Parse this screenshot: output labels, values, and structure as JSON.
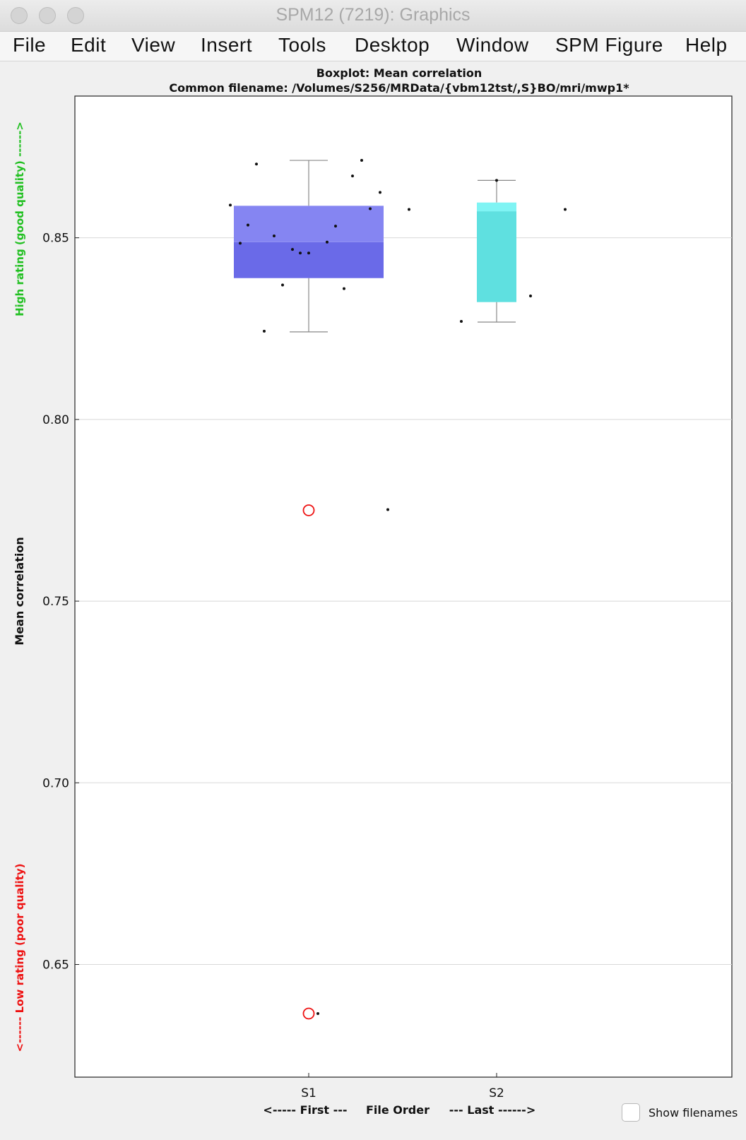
{
  "window": {
    "title": "SPM12 (7219): Graphics"
  },
  "menu": [
    "File",
    "Edit",
    "View",
    "Insert",
    "Tools",
    "Desktop",
    "Window",
    "SPM Figure",
    "Help"
  ],
  "footer": {
    "first_label": "<----- First ---",
    "order_label": "File Order",
    "last_label": "--- Last ------>",
    "show_filenames_label": "Show filenames"
  },
  "colors": {
    "s1_box": "#6a6ae8",
    "s1_box_upper": "#8585f2",
    "s2_box": "#5fe0e0",
    "s2_box_upper": "#7ff4f4",
    "good": "#22c022",
    "poor": "#ee1111",
    "outlier": "#ee1111"
  },
  "chart_data": {
    "type": "box",
    "title": "Boxplot: Mean correlation",
    "subtitle": "Common filename: /Volumes/S256/MRData/{vbm12tst/,S}BO/mri/mwp1*",
    "xlabel": "",
    "ylabel": "Mean correlation",
    "ylabel_high": "High rating (good quality) ------>",
    "ylabel_low": "<------ Low rating (poor quality)",
    "categories": [
      "S1",
      "S2"
    ],
    "ylim": [
      0.619,
      0.889
    ],
    "yticks": [
      0.65,
      0.7,
      0.75,
      0.8,
      0.85
    ],
    "ytick_labels": [
      "0.65",
      "0.70",
      "0.75",
      "0.80",
      "0.85"
    ],
    "grid": true,
    "boxes": [
      {
        "name": "S1",
        "q1": 0.8389,
        "median": 0.8488,
        "q3": 0.8588,
        "whisker_low": 0.8241,
        "whisker_high": 0.8713
      },
      {
        "name": "S2",
        "q1": 0.8323,
        "median": 0.8573,
        "q3": 0.8597,
        "whisker_low": 0.8268,
        "whisker_high": 0.8658
      }
    ],
    "outliers": [
      {
        "series": "S1",
        "y": 0.775
      },
      {
        "series": "S1",
        "y": 0.6365
      }
    ],
    "points": [
      {
        "series": "S1",
        "offset": -1.11,
        "y": 0.859
      },
      {
        "series": "S1",
        "offset": -0.97,
        "y": 0.8485
      },
      {
        "series": "S1",
        "offset": -0.86,
        "y": 0.8535
      },
      {
        "series": "S1",
        "offset": -0.74,
        "y": 0.8703
      },
      {
        "series": "S1",
        "offset": -0.63,
        "y": 0.8243
      },
      {
        "series": "S1",
        "offset": -0.49,
        "y": 0.8505
      },
      {
        "series": "S1",
        "offset": -0.37,
        "y": 0.837
      },
      {
        "series": "S1",
        "offset": -0.23,
        "y": 0.8468
      },
      {
        "series": "S1",
        "offset": -0.12,
        "y": 0.8458
      },
      {
        "series": "S1",
        "offset": 0.0,
        "y": 0.8458
      },
      {
        "series": "S1",
        "offset": 0.26,
        "y": 0.8488
      },
      {
        "series": "S1",
        "offset": 0.38,
        "y": 0.8532
      },
      {
        "series": "S1",
        "offset": 0.5,
        "y": 0.836
      },
      {
        "series": "S1",
        "offset": 0.62,
        "y": 0.867
      },
      {
        "series": "S1",
        "offset": 0.75,
        "y": 0.8713
      },
      {
        "series": "S1",
        "offset": 0.87,
        "y": 0.858
      },
      {
        "series": "S1",
        "offset": 1.01,
        "y": 0.8625
      },
      {
        "series": "S1",
        "offset": 1.12,
        "y": 0.7752
      },
      {
        "series": "S1",
        "offset": 1.42,
        "y": 0.8578
      },
      {
        "series": "S1",
        "offset": 0.13,
        "y": 0.6365
      },
      {
        "series": "S2",
        "offset": -0.5,
        "y": 0.827
      },
      {
        "series": "S2",
        "offset": 0.0,
        "y": 0.8658
      },
      {
        "series": "S2",
        "offset": 0.48,
        "y": 0.834
      },
      {
        "series": "S2",
        "offset": 0.97,
        "y": 0.8578
      }
    ]
  }
}
